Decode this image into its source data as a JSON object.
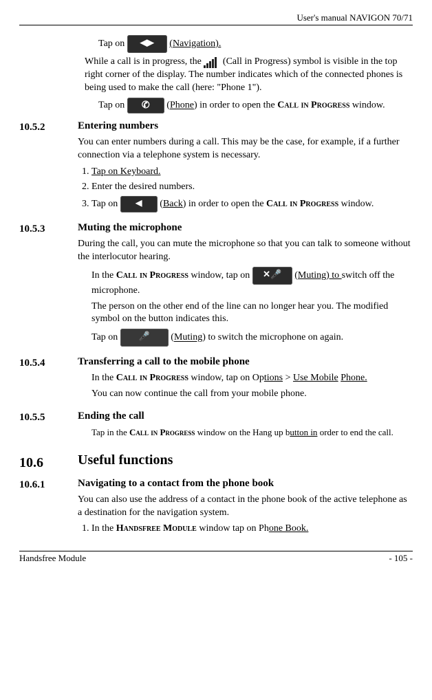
{
  "header_title": "User's manual NAVIGON 70/71",
  "p_tap_nav_pre": "Tap on ",
  "p_tap_nav_post": " (Navigation).",
  "p_call_progress_a": "While a call is in progress, the ",
  "p_call_progress_b": " (Call in Progress) symbol is visible in the top right corner of the display. The number indicates which of the connected phones is being used to make the call (here: \"Phone 1\").",
  "p_tap_phone_pre": "Tap on ",
  "p_tap_phone_mid": " (Phone) in order to open the ",
  "p_tap_phone_sc": "Call in Progress",
  "p_tap_phone_post": " window.",
  "s1052_num": "10.5.2",
  "s1052_title": "Entering numbers",
  "s1052_intro": "You can enter numbers during a call. This may be the case, for example, if a further connection via a telephone system is necessary.",
  "s1052_step1": "Tap on Keyboard.",
  "s1052_step2": "Enter the desired numbers.",
  "s1052_step3_pre": "Tap on ",
  "s1052_step3_mid": " (Back) in order to open the ",
  "s1052_step3_sc": "Call in Progress",
  "s1052_step3_post": " window.",
  "s1053_num": "10.5.3",
  "s1053_title": "Muting the microphone",
  "s1053_intro": "During the call, you can mute the microphone so that you can talk to someone without the interlocutor hearing.",
  "s1053_b1_pre": "In the ",
  "s1053_b1_sc": "Call in Progress",
  "s1053_b1_mid": " window, tap on ",
  "s1053_b1_post": " (Muting) to switch off the microphone.",
  "s1053_b2": "The person on the other end of the line can no longer hear you. The modified symbol on the button indicates this.",
  "s1053_b3_pre": "Tap on ",
  "s1053_b3_post": " (Muting) to switch the microphone on again.",
  "s1054_num": "10.5.4",
  "s1054_title": "Transferring a call to the mobile phone",
  "s1054_b1_pre": "In the ",
  "s1054_b1_sc": "Call in Progress",
  "s1054_b1_mid": " window, tap on Options > Use Mobile Phone.",
  "s1054_b2": "You can now continue the call from your mobile phone.",
  "s1055_num": "10.5.5",
  "s1055_title": "Ending the call",
  "s1055_b1_pre": "Tap in the ",
  "s1055_b1_sc": "Call in Progress",
  "s1055_b1_post": " window on the Hang up button in order to end the call.",
  "s106_num": "10.6",
  "s106_title": "Useful functions",
  "s1061_num": "10.6.1",
  "s1061_title": "Navigating to a contact from the phone book",
  "s1061_intro": "You can also use the address of a contact in the phone book of the active telephone as a destination for the navigation system.",
  "s1061_step1_pre": "In the ",
  "s1061_step1_sc": "Handsfree Module",
  "s1061_step1_post": " window tap on Phone Book.",
  "footer_left": "Handsfree Module",
  "footer_right": "- 105 -",
  "icons": {
    "nav": "◀▶",
    "phone": "✆",
    "back": "◀",
    "mute": "✕🎤",
    "mute2": "🎤"
  }
}
